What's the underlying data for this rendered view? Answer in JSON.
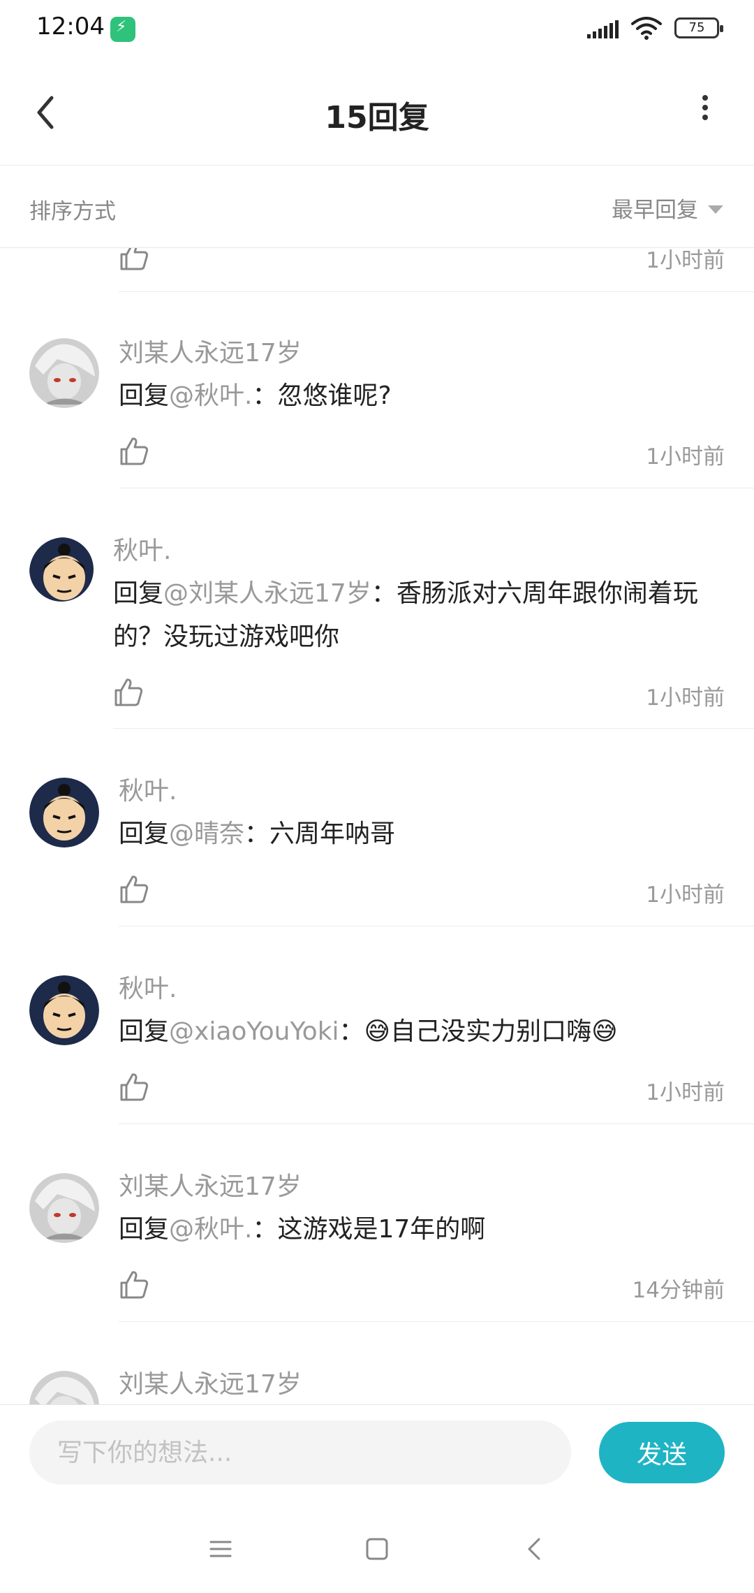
{
  "status_bar": {
    "time": "12:04",
    "battery": "75"
  },
  "header": {
    "title": "15回复"
  },
  "sort": {
    "label": "排序方式",
    "selected": "最早回复"
  },
  "top_partial": {
    "timestamp": "1小时前"
  },
  "comments": [
    {
      "user": "刘某人永远17岁",
      "prefix": "回复",
      "mention": "@秋叶.",
      "text": "：忽悠谁呢?",
      "time": "1小时前",
      "avatar": "gray-anime"
    },
    {
      "user": "秋叶.",
      "prefix": "回复",
      "mention": "@刘某人永远17岁",
      "text": "：香肠派对六周年跟你闹着玩的？没玩过游戏吧你",
      "time": "1小时前",
      "avatar": "cartoon-boy"
    },
    {
      "user": "秋叶.",
      "prefix": "回复",
      "mention": "@晴奈",
      "text": "：六周年呐哥",
      "time": "1小时前",
      "avatar": "cartoon-boy"
    },
    {
      "user": "秋叶.",
      "prefix": "回复",
      "mention": "@xiaoYouYoki",
      "text": "：😅自己没实力别口嗨😅",
      "time": "1小时前",
      "avatar": "cartoon-boy"
    },
    {
      "user": "刘某人永远17岁",
      "prefix": "回复",
      "mention": "@秋叶.",
      "text": "：这游戏是17年的啊",
      "time": "14分钟前",
      "avatar": "gray-anime"
    },
    {
      "user": "刘某人永远17岁",
      "avatar": "gray-anime"
    }
  ],
  "input": {
    "placeholder": "写下你的想法...",
    "send_label": "发送"
  },
  "colors": {
    "accent": "#1fb4c4",
    "muted_text": "#999999",
    "body_text": "#222222"
  },
  "icons": [
    "back-arrow-icon",
    "more-vertical-icon",
    "caret-down-icon",
    "thumbs-up-icon",
    "menu-icon",
    "home-square-icon",
    "nav-back-icon"
  ]
}
